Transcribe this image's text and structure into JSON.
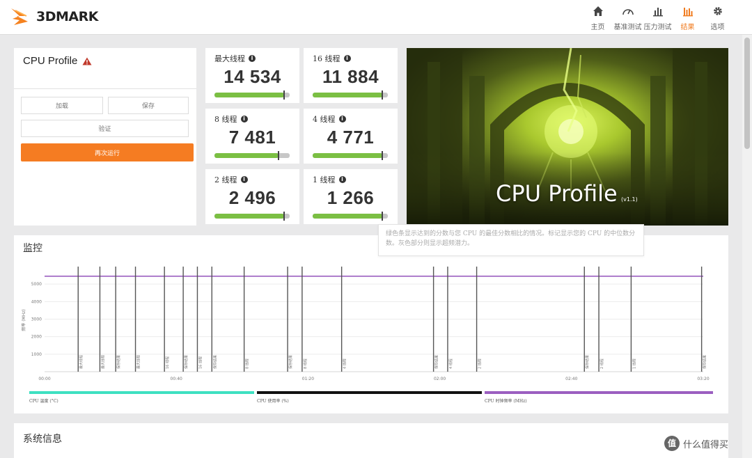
{
  "app": {
    "logo_text": "3DMARK",
    "accent_color": "#f57c22"
  },
  "nav": [
    {
      "label": "主页",
      "icon": "home-icon",
      "active": false
    },
    {
      "label": "基准测试",
      "icon": "gauge-icon",
      "active": false
    },
    {
      "label": "压力测试",
      "icon": "stress-chart-icon",
      "active": false
    },
    {
      "label": "结果",
      "icon": "results-chart-icon",
      "active": true
    },
    {
      "label": "选项",
      "icon": "gear-icon",
      "active": false
    }
  ],
  "left_panel": {
    "title": "CPU Profile",
    "warning_icon": "warning-icon",
    "load_label": "加载",
    "save_label": "保存",
    "verify_label": "验证",
    "run_again_label": "再次运行"
  },
  "scores": [
    {
      "label": "最大线程",
      "value": "14 534",
      "bar_fraction": 0.93
    },
    {
      "label": "16 线程",
      "value": "11 884",
      "bar_fraction": 0.93
    },
    {
      "label": "8 线程",
      "value": "7 481",
      "bar_fraction": 0.85
    },
    {
      "label": "4 线程",
      "value": "4 771",
      "bar_fraction": 0.93
    },
    {
      "label": "2 线程",
      "value": "2 496",
      "bar_fraction": 0.93
    },
    {
      "label": "1 线程",
      "value": "1 266",
      "bar_fraction": 0.93
    }
  ],
  "hero": {
    "title": "CPU Profile",
    "version": "(v1.1)"
  },
  "tooltip": {
    "text": "绿色条显示达到的分数与您 CPU 的最佳分数相比的情况。标记显示您的 CPU 的中位数分数。灰色部分则显示超频潜力。"
  },
  "monitor": {
    "title": "监控",
    "legend": [
      {
        "label": "CPU 温度 (°C)",
        "color": "#3ee0c1"
      },
      {
        "label": "CPU 使用率 (%)",
        "color": "#111111"
      },
      {
        "label": "CPU 时钟频率 (MHz)",
        "color": "#9b5fc0"
      }
    ]
  },
  "chart_data": {
    "type": "line",
    "ylabel": "频率 (MHz)",
    "ylim": [
      0,
      6000
    ],
    "y_ticks": [
      1000,
      2000,
      3000,
      4000,
      5000
    ],
    "x_ticks": [
      "00:00",
      "00:40",
      "01:20",
      "02:00",
      "02:40",
      "03:20"
    ],
    "x_range_seconds": [
      0,
      200
    ],
    "series": [
      {
        "name": "CPU 时钟频率 (MHz)",
        "color": "#9b5fc0",
        "x": [
          0,
          200
        ],
        "y": [
          5450,
          5450
        ]
      }
    ],
    "markers": [
      {
        "t": 10.2,
        "label": "最大线程"
      },
      {
        "t": 16.8,
        "label": "最大线程"
      },
      {
        "t": 21.6,
        "label": "保存结果"
      },
      {
        "t": 27.6,
        "label": "最大线程"
      },
      {
        "t": 36.4,
        "label": "16 线程"
      },
      {
        "t": 42.1,
        "label": "保存结果"
      },
      {
        "t": 46.4,
        "label": "16 线程"
      },
      {
        "t": 50.8,
        "label": "保存结果"
      },
      {
        "t": 60.6,
        "label": "8 线程"
      },
      {
        "t": 73.8,
        "label": "保存结果"
      },
      {
        "t": 78.2,
        "label": "8 线程"
      },
      {
        "t": 90.2,
        "label": "4 线程"
      },
      {
        "t": 118.1,
        "label": "保存结果"
      },
      {
        "t": 122.4,
        "label": "4 线程"
      },
      {
        "t": 131.2,
        "label": "2 线程"
      },
      {
        "t": 163.9,
        "label": "保存结果"
      },
      {
        "t": 168.3,
        "label": "2 线程"
      },
      {
        "t": 178.1,
        "label": "1 线程"
      },
      {
        "t": 199.5,
        "label": "保存结果"
      }
    ]
  },
  "sysinfo": {
    "title": "系统信息"
  },
  "watermark": {
    "text": "什么值得买",
    "icon_char": "值"
  }
}
